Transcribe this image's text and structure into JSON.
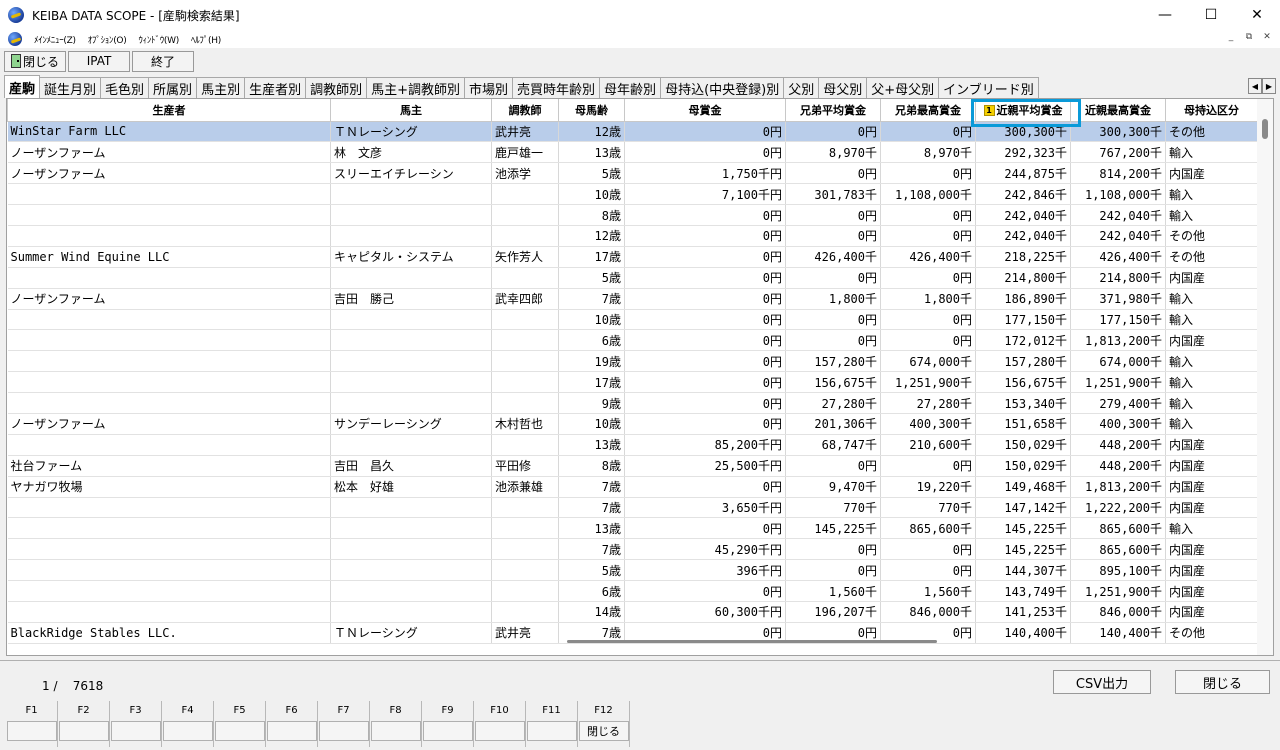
{
  "window": {
    "title": "KEIBA DATA SCOPE - [産駒検索結果]",
    "controls": [
      "—",
      "☐",
      "✕"
    ]
  },
  "menu": {
    "items": [
      "ﾒｲﾝﾒﾆｭｰ(Z)",
      "ｵﾌﾟｼｮﾝ(O)",
      "ｳｨﾝﾄﾞｳ(W)",
      "ﾍﾙﾌﾟ(H)"
    ],
    "mdi": [
      "_",
      "⧉",
      "✕"
    ]
  },
  "toolbar": {
    "close_label": "閉じる",
    "ipat_label": "IPAT",
    "exit_label": "終了"
  },
  "tabs": [
    "産駒",
    "誕生月別",
    "毛色別",
    "所属別",
    "馬主別",
    "生産者別",
    "調教師別",
    "馬主+調教師別",
    "市場別",
    "売買時年齢別",
    "母年齢別",
    "母持込(中央登録)別",
    "父別",
    "母父別",
    "父+母父別",
    "インブリード別"
  ],
  "grid": {
    "columns": [
      "生産者",
      "馬主",
      "調教師",
      "母馬齢",
      "母賞金",
      "兄弟平均賞金",
      "兄弟最高賞金",
      "近親平均賞金",
      "近親最高賞金",
      "母持込区分"
    ],
    "sort_badge": "1",
    "rows": [
      [
        "WinStar Farm LLC",
        "ＴＮレーシング",
        "武井亮",
        "12歳",
        "0円",
        "0円",
        "0円",
        "300,300千",
        "300,300千",
        "その他"
      ],
      [
        "ノーザンファーム",
        "林　文彦",
        "鹿戸雄一",
        "13歳",
        "0円",
        "8,970千",
        "8,970千",
        "292,323千",
        "767,200千",
        "輸入"
      ],
      [
        "ノーザンファーム",
        "スリーエイチレーシン",
        "池添学",
        "5歳",
        "1,750千円",
        "0円",
        "0円",
        "244,875千",
        "814,200千",
        "内国産"
      ],
      [
        "",
        "",
        "",
        "10歳",
        "7,100千円",
        "301,783千",
        "1,108,000千",
        "242,846千",
        "1,108,000千",
        "輸入"
      ],
      [
        "",
        "",
        "",
        "8歳",
        "0円",
        "0円",
        "0円",
        "242,040千",
        "242,040千",
        "輸入"
      ],
      [
        "",
        "",
        "",
        "12歳",
        "0円",
        "0円",
        "0円",
        "242,040千",
        "242,040千",
        "その他"
      ],
      [
        "Summer Wind Equine LLC",
        "キャピタル・システム",
        "矢作芳人",
        "17歳",
        "0円",
        "426,400千",
        "426,400千",
        "218,225千",
        "426,400千",
        "その他"
      ],
      [
        "",
        "",
        "",
        "5歳",
        "0円",
        "0円",
        "0円",
        "214,800千",
        "214,800千",
        "内国産"
      ],
      [
        "ノーザンファーム",
        "吉田　勝己",
        "武幸四郎",
        "7歳",
        "0円",
        "1,800千",
        "1,800千",
        "186,890千",
        "371,980千",
        "輸入"
      ],
      [
        "",
        "",
        "",
        "10歳",
        "0円",
        "0円",
        "0円",
        "177,150千",
        "177,150千",
        "輸入"
      ],
      [
        "",
        "",
        "",
        "6歳",
        "0円",
        "0円",
        "0円",
        "172,012千",
        "1,813,200千",
        "内国産"
      ],
      [
        "",
        "",
        "",
        "19歳",
        "0円",
        "157,280千",
        "674,000千",
        "157,280千",
        "674,000千",
        "輸入"
      ],
      [
        "",
        "",
        "",
        "17歳",
        "0円",
        "156,675千",
        "1,251,900千",
        "156,675千",
        "1,251,900千",
        "輸入"
      ],
      [
        "",
        "",
        "",
        "9歳",
        "0円",
        "27,280千",
        "27,280千",
        "153,340千",
        "279,400千",
        "輸入"
      ],
      [
        "ノーザンファーム",
        "サンデーレーシング",
        "木村哲也",
        "10歳",
        "0円",
        "201,306千",
        "400,300千",
        "151,658千",
        "400,300千",
        "輸入"
      ],
      [
        "",
        "",
        "",
        "13歳",
        "85,200千円",
        "68,747千",
        "210,600千",
        "150,029千",
        "448,200千",
        "内国産"
      ],
      [
        "社台ファーム",
        "吉田　昌久",
        "平田修",
        "8歳",
        "25,500千円",
        "0円",
        "0円",
        "150,029千",
        "448,200千",
        "内国産"
      ],
      [
        "ヤナガワ牧場",
        "松本　好雄",
        "池添兼雄",
        "7歳",
        "0円",
        "9,470千",
        "19,220千",
        "149,468千",
        "1,813,200千",
        "内国産"
      ],
      [
        "",
        "",
        "",
        "7歳",
        "3,650千円",
        "770千",
        "770千",
        "147,142千",
        "1,222,200千",
        "内国産"
      ],
      [
        "",
        "",
        "",
        "13歳",
        "0円",
        "145,225千",
        "865,600千",
        "145,225千",
        "865,600千",
        "輸入"
      ],
      [
        "",
        "",
        "",
        "7歳",
        "45,290千円",
        "0円",
        "0円",
        "145,225千",
        "865,600千",
        "内国産"
      ],
      [
        "",
        "",
        "",
        "5歳",
        "396千円",
        "0円",
        "0円",
        "144,307千",
        "895,100千",
        "内国産"
      ],
      [
        "",
        "",
        "",
        "6歳",
        "0円",
        "1,560千",
        "1,560千",
        "143,749千",
        "1,251,900千",
        "内国産"
      ],
      [
        "",
        "",
        "",
        "14歳",
        "60,300千円",
        "196,207千",
        "846,000千",
        "141,253千",
        "846,000千",
        "内国産"
      ],
      [
        "BlackRidge Stables LLC.",
        "ＴＮレーシング",
        "武井亮",
        "7歳",
        "0円",
        "0円",
        "0円",
        "140,400千",
        "140,400千",
        "その他"
      ]
    ]
  },
  "footer": {
    "page_current": "1",
    "page_total": "7618",
    "csv_label": "CSV出力",
    "close_label": "閉じる"
  },
  "fkeys": [
    {
      "key": "F1",
      "label": ""
    },
    {
      "key": "F2",
      "label": ""
    },
    {
      "key": "F3",
      "label": ""
    },
    {
      "key": "F4",
      "label": ""
    },
    {
      "key": "F5",
      "label": ""
    },
    {
      "key": "F6",
      "label": ""
    },
    {
      "key": "F7",
      "label": ""
    },
    {
      "key": "F8",
      "label": ""
    },
    {
      "key": "F9",
      "label": ""
    },
    {
      "key": "F10",
      "label": ""
    },
    {
      "key": "F11",
      "label": ""
    },
    {
      "key": "F12",
      "label": "閉じる"
    }
  ],
  "colors": {
    "selected_row": "#b9cdea",
    "highlight_frame": "#0a9ad8",
    "sort_badge": "#f5d000"
  }
}
